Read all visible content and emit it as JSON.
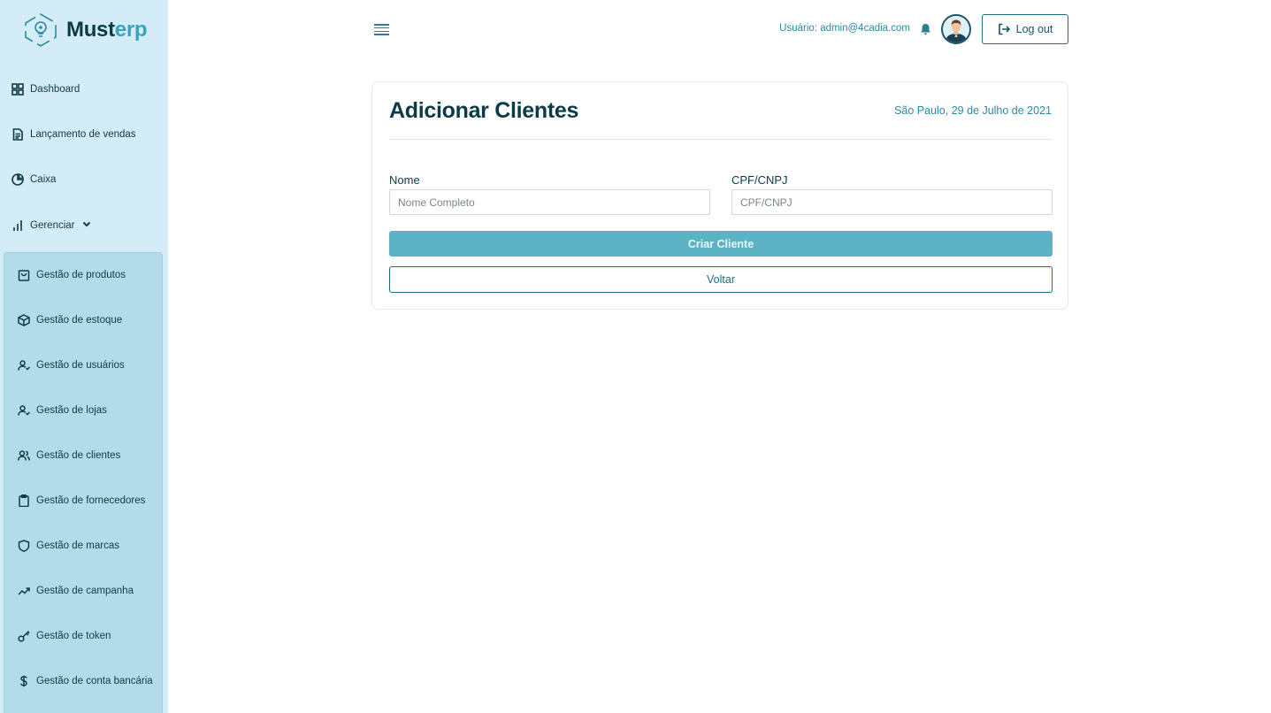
{
  "brand": {
    "name_part1": "Must",
    "name_part2": "erp"
  },
  "sidebar": {
    "items": [
      {
        "label": "Dashboard",
        "icon": "grid-icon"
      },
      {
        "label": "Lançamento de vendas",
        "icon": "document-icon"
      },
      {
        "label": "Caixa",
        "icon": "pie-chart-icon"
      },
      {
        "label": "Gerenciar",
        "icon": "bar-chart-icon"
      }
    ],
    "submenu": [
      {
        "label": "Gestão de produtos",
        "icon": "shopping-bag-icon"
      },
      {
        "label": "Gestão de estoque",
        "icon": "box-icon"
      },
      {
        "label": "Gestão de usuários",
        "icon": "user-check-icon"
      },
      {
        "label": "Gestão de lojas",
        "icon": "user-check-icon"
      },
      {
        "label": "Gestão de clientes",
        "icon": "users-icon"
      },
      {
        "label": "Gestão de fornecedores",
        "icon": "clipboard-icon"
      },
      {
        "label": "Gestão de marcas",
        "icon": "shield-icon"
      },
      {
        "label": "Gestão de campanha",
        "icon": "trending-up-icon"
      },
      {
        "label": "Gestão de token",
        "icon": "key-icon"
      },
      {
        "label": "Gestão de conta bancária",
        "icon": "dollar-icon"
      }
    ]
  },
  "header": {
    "user_text": "Usuário: admin@4cadia.com",
    "logout_label": "Log out"
  },
  "form": {
    "title": "Adicionar Clientes",
    "date": "São Paulo, 29 de Julho de 2021",
    "name_label": "Nome",
    "name_placeholder": "Nome Completo",
    "doc_label": "CPF/CNPJ",
    "doc_placeholder": "CPF/CNPJ",
    "submit_label": "Criar Cliente",
    "back_label": "Voltar"
  },
  "colors": {
    "sidebar_bg": "#d3ecf7",
    "submenu_bg": "#b3dceb",
    "primary": "#5cb3c4",
    "accent": "#2a8aa0",
    "dark": "#0b3b47"
  }
}
